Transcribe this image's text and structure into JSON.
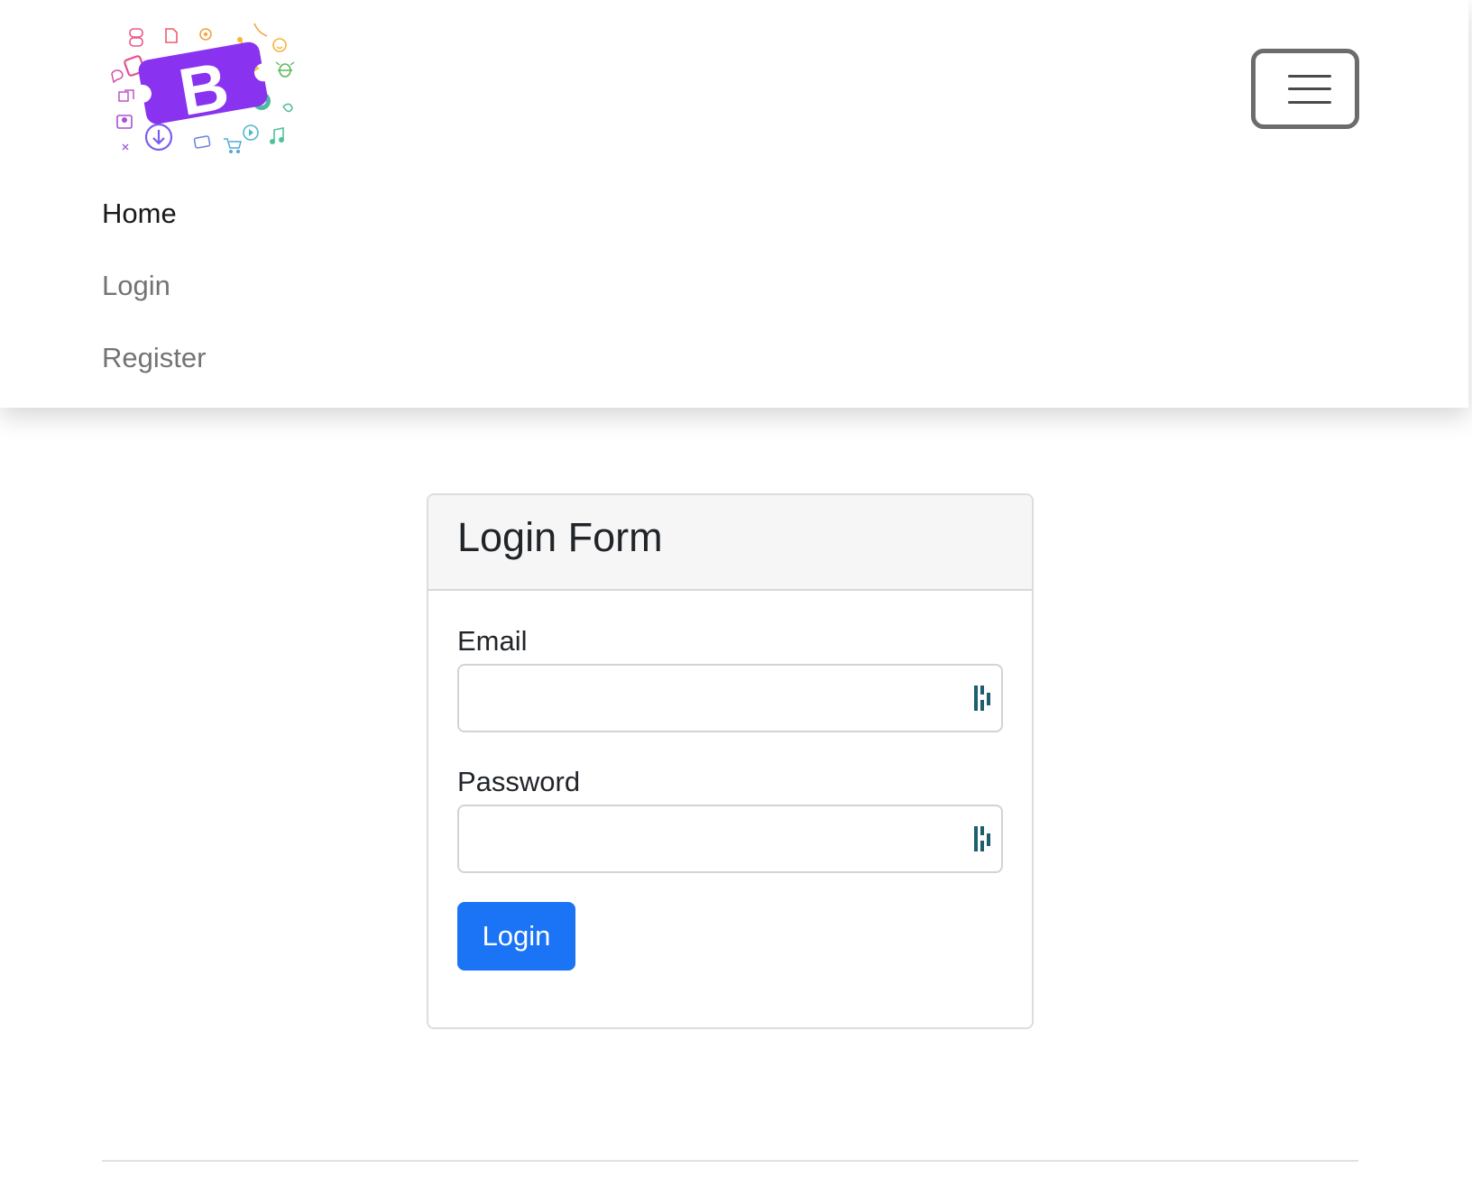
{
  "navbar": {
    "brand_letter": "B",
    "links": [
      "Home",
      "Login",
      "Register"
    ],
    "toggler_icon": "hamburger-menu-icon"
  },
  "login_form": {
    "title": "Login Form",
    "email_label": "Email",
    "email_value": "",
    "password_label": "Password",
    "password_value": "",
    "field_icon": "password-manager-icon",
    "submit_label": "Login"
  },
  "colors": {
    "brand_purple": "#7c2bf0",
    "primary_button": "#1a74f5",
    "password_icon": "#1d5e6f"
  }
}
